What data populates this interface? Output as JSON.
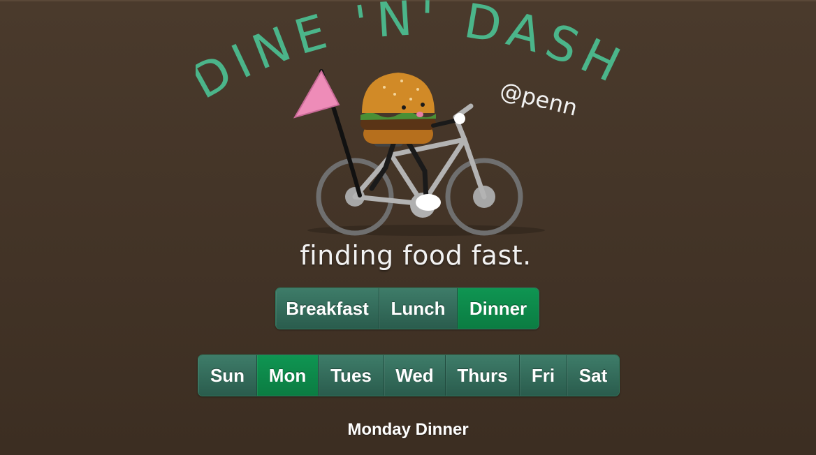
{
  "logo": {
    "title": "DINE 'N' DASH",
    "subtitle": "@penn",
    "tagline": "finding food fast."
  },
  "meals": {
    "items": [
      "Breakfast",
      "Lunch",
      "Dinner"
    ],
    "selected": "Dinner"
  },
  "days": {
    "items": [
      "Sun",
      "Mon",
      "Tues",
      "Wed",
      "Thurs",
      "Fri",
      "Sat"
    ],
    "selected": "Mon"
  },
  "heading": "Monday Dinner",
  "colors": {
    "background": "#45362a",
    "title_green": "#4bb58a",
    "button_teal": "#2f6b5a",
    "button_active": "#0d8a4b",
    "flag_pink": "#ee8cb8"
  }
}
